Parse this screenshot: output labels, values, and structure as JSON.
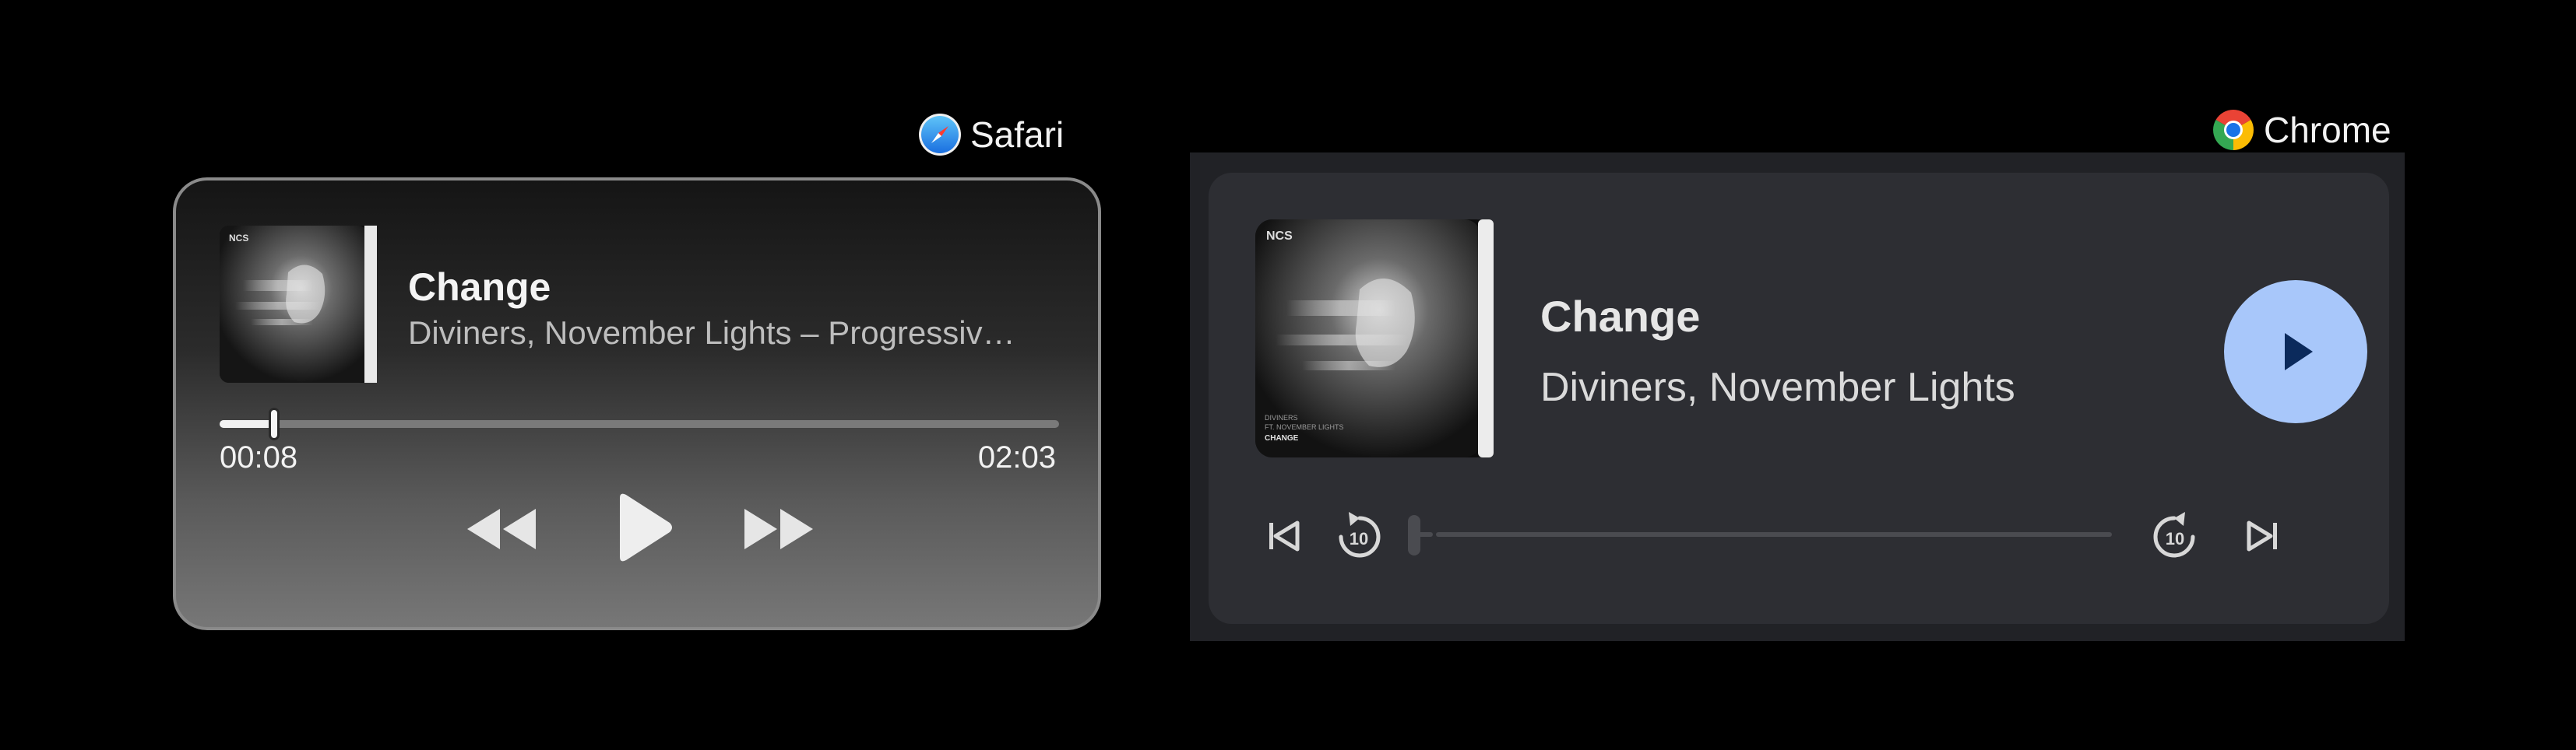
{
  "labels": {
    "safari": "Safari",
    "chrome": "Chrome"
  },
  "safari_player": {
    "title": "Change",
    "artist": "Diviners, November Lights – Progressiv…",
    "elapsed": "00:08",
    "duration": "02:03",
    "progress": 0.065,
    "artwork_badge": "NCS",
    "controls": [
      "rewind",
      "play",
      "fast-forward"
    ]
  },
  "chrome_player": {
    "title": "Change",
    "artist": "Diviners, November Lights",
    "progress": 0.0,
    "artwork_badge": "NCS",
    "artwork_caption_1": "DIVINERS",
    "artwork_caption_2": "FT. NOVEMBER LIGHTS",
    "artwork_caption_3": "CHANGE",
    "seek_step_label": "10",
    "controls": [
      "previous-track",
      "replay-10",
      "play",
      "forward-10",
      "next-track"
    ]
  },
  "colors": {
    "background": "#000000",
    "chrome_play_button": "#a8c7fa",
    "chrome_play_icon": "#0b2a5c",
    "chrome_card": "#2d2e33"
  },
  "icons": {
    "safari": "safari-compass-icon",
    "chrome": "chrome-logo-icon"
  }
}
